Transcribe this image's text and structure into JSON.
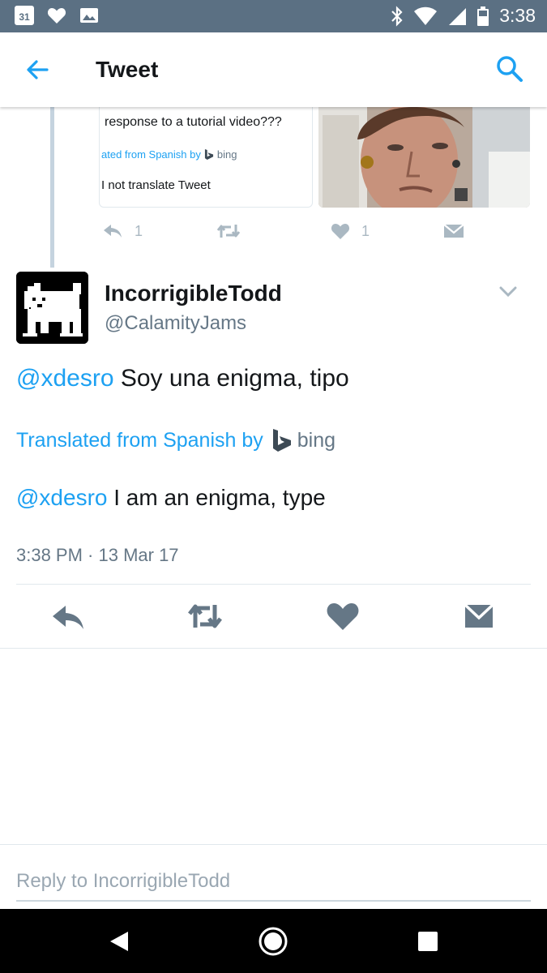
{
  "status_bar": {
    "calendar_day": "31",
    "time": "3:38",
    "left_icons": [
      "calendar-icon",
      "heart-icon",
      "image-icon"
    ],
    "right_icons": [
      "bluetooth-icon",
      "wifi-icon",
      "signal-icon",
      "battery-icon"
    ]
  },
  "app_bar": {
    "title": "Tweet",
    "back_icon": "arrow-left-icon",
    "search_icon": "search-icon",
    "accent_color": "#1da1f2"
  },
  "previous_tweet": {
    "text_fragment": "response to a tutorial video???",
    "translated_fragment": "ated from Spanish by",
    "bing_label": "bing",
    "do_not_translate": "I not translate Tweet",
    "reply_count": "1",
    "like_count": "1"
  },
  "tweet": {
    "display_name": "IncorrigibleTodd",
    "handle": "@CalamityJams",
    "mention": "@xdesro",
    "text": "Soy una enigma, tipo",
    "translated_label": "Translated from Spanish by",
    "bing_label": "bing",
    "translation_mention": "@xdesro",
    "translation": "I am an enigma, type",
    "timestamp": "3:38 PM · 13 Mar 17"
  },
  "actions": [
    "reply-icon",
    "retweet-icon",
    "like-icon",
    "direct-message-icon"
  ],
  "reply_bar": {
    "placeholder": "Reply to IncorrigibleTodd"
  },
  "nav_bar": {
    "buttons": [
      "back-triangle-icon",
      "home-circle-icon",
      "overview-square-icon"
    ]
  }
}
